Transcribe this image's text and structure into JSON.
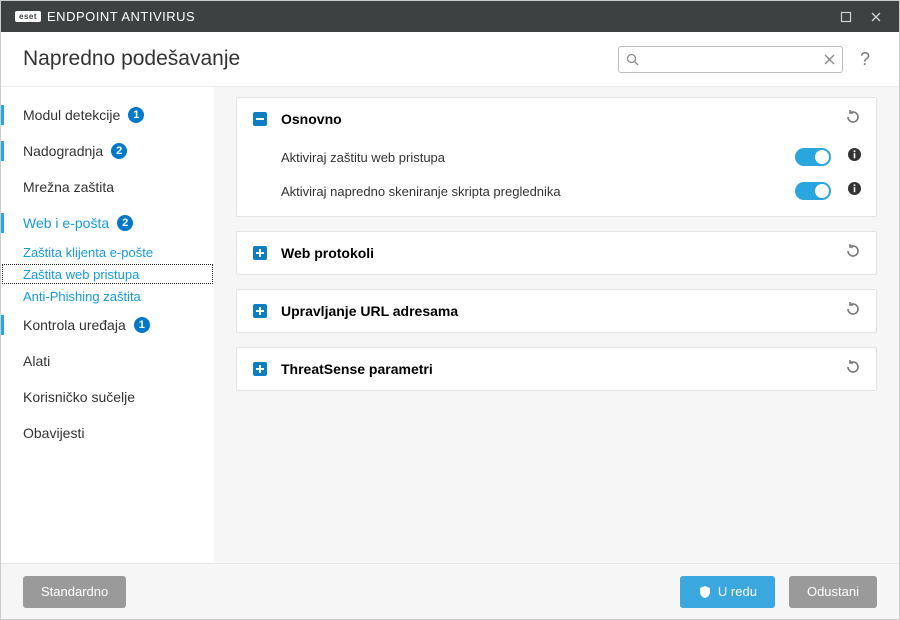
{
  "app": {
    "brand": "eset",
    "name": "ENDPOINT ANTIVIRUS"
  },
  "page_title": "Napredno podešavanje",
  "search": {
    "value": "",
    "placeholder": ""
  },
  "sidebar": {
    "items": [
      {
        "label": "Modul detekcije",
        "badge": "1"
      },
      {
        "label": "Nadogradnja",
        "badge": "2"
      },
      {
        "label": "Mrežna zaštita"
      },
      {
        "label": "Web i e-pošta",
        "badge": "2",
        "link": true,
        "subs": [
          {
            "label": "Zaštita klijenta e-pošte"
          },
          {
            "label": "Zaštita web pristupa",
            "active": true
          },
          {
            "label": "Anti-Phishing zaštita"
          }
        ]
      },
      {
        "label": "Kontrola uređaja",
        "badge": "1"
      },
      {
        "label": "Alati"
      },
      {
        "label": "Korisničko sučelje"
      },
      {
        "label": "Obavijesti"
      }
    ]
  },
  "sections": [
    {
      "title": "Osnovno",
      "expanded": true,
      "rows": [
        {
          "label": "Aktiviraj zaštitu web pristupa",
          "on": true
        },
        {
          "label": "Aktiviraj napredno skeniranje skripta preglednika",
          "on": true
        }
      ]
    },
    {
      "title": "Web protokoli",
      "expanded": false
    },
    {
      "title": "Upravljanje URL adresama",
      "expanded": false
    },
    {
      "title": "ThreatSense parametri",
      "expanded": false
    }
  ],
  "footer": {
    "default": "Standardno",
    "ok": "U redu",
    "cancel": "Odustani"
  }
}
